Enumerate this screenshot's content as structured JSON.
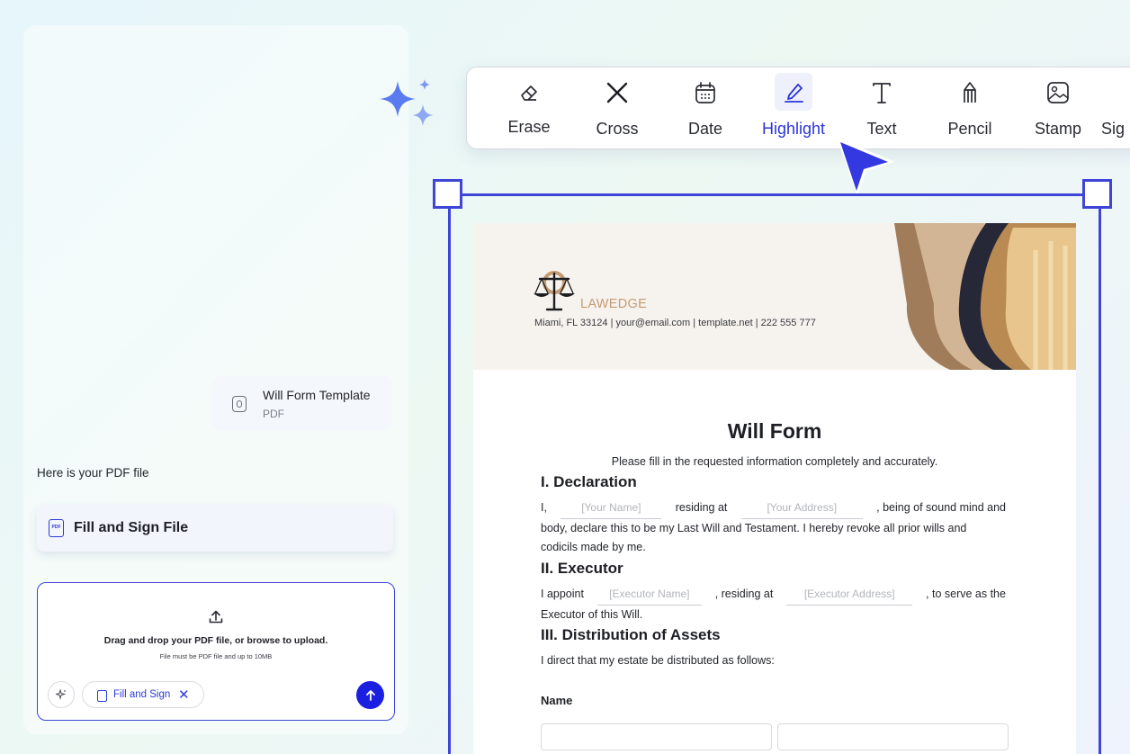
{
  "chat": {
    "file_card": {
      "name": "Will Form Template",
      "type": "PDF"
    },
    "message": "Here is your PDF file",
    "fill_button_label": "Fill and Sign File",
    "upload": {
      "drag_text": "Drag and drop your PDF file, or browse to upload.",
      "limit_text": "File must be PDF file and up to 10MB",
      "chip_label": "Fill and Sign",
      "chip_close": "✕"
    }
  },
  "toolbar": {
    "tools": [
      {
        "label": "Erase",
        "icon": "eraser-icon"
      },
      {
        "label": "Cross",
        "icon": "cross-icon"
      },
      {
        "label": "Date",
        "icon": "calendar-icon"
      },
      {
        "label": "Highlight",
        "icon": "highlighter-icon",
        "active": true
      },
      {
        "label": "Text",
        "icon": "text-icon"
      },
      {
        "label": "Pencil",
        "icon": "pencil-icon"
      },
      {
        "label": "Stamp",
        "icon": "stamp-icon"
      },
      {
        "label": "Sig",
        "icon": "signature-icon"
      }
    ]
  },
  "document": {
    "brand": "LAWEDGE",
    "contact": "Miami, FL 33124 | your@email.com | template.net | 222 555 777",
    "title": "Will Form",
    "intro": "Please fill in the requested information completely and accurately.",
    "declaration": {
      "heading": "I. Declaration",
      "w1": "I,",
      "name_ph": "[Your Name]",
      "w2": "residing at",
      "address_ph": "[Your Address]",
      "w3": ", being of sound mind and",
      "line2": "body, declare this to be my Last Will and Testament. I hereby revoke all prior wills and",
      "line3": "codicils made by me."
    },
    "executor": {
      "heading": "II. Executor",
      "w1": "I appoint",
      "name_ph": "[Executor Name]",
      "w2": ", residing at",
      "address_ph": "[Executor Address]",
      "w3": ", to serve as the",
      "line2": "Executor of this Will."
    },
    "distribution": {
      "heading": "III. Distribution of Assets",
      "line1": "I direct that my estate be distributed as follows:",
      "name_label": "Name"
    }
  },
  "colors": {
    "accent": "#2b34d9",
    "frame": "#3f45d6",
    "brand": "#c59a72"
  }
}
